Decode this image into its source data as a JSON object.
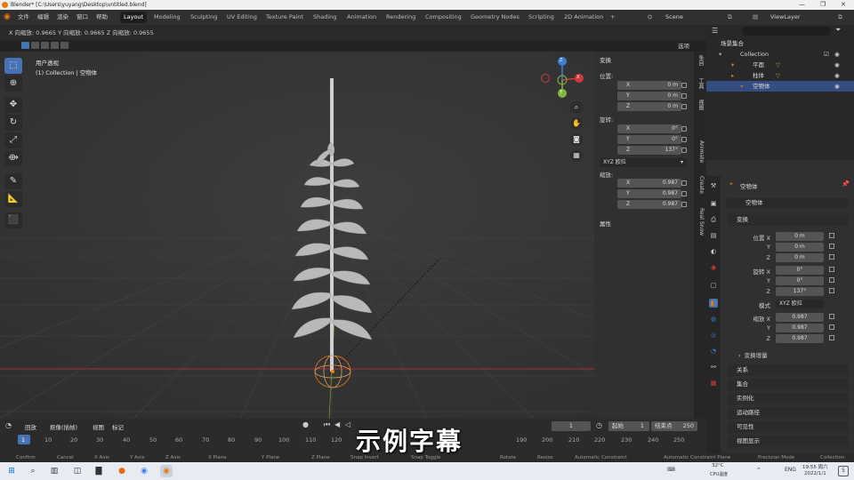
{
  "title_bar": {
    "title": "Blender* [C:\\Users\\yuyang\\Desktop\\untitled.blend]",
    "minimize": "—",
    "maximize": "❐",
    "close": "✕"
  },
  "menu": {
    "items": [
      "文件",
      "编辑",
      "渲染",
      "窗口",
      "帮助"
    ],
    "workspaces": [
      "Layout",
      "Modeling",
      "Sculpting",
      "UV Editing",
      "Texture Paint",
      "Shading",
      "Animation",
      "Rendering",
      "Compositing",
      "Geometry Nodes",
      "Scripting",
      "2D Animation"
    ],
    "active_workspace": "Layout",
    "add_tab": "+",
    "scene_name": "Scene",
    "view_layer": "ViewLayer"
  },
  "tool_header": {
    "scale_readout": "X 向缩放: 0.9665  Y 向缩放: 0.9665  Z 向缩放: 0.9655",
    "options_label": "选项"
  },
  "viewport": {
    "view_name": "用户透视",
    "context_line": "(1) Collection | 空物体",
    "gizmo_axes": {
      "x": "X",
      "y": "Y",
      "z": "Z"
    },
    "colors": {
      "bg": "#393939",
      "x_axis": "#d43a3a",
      "y_axis": "#7fb83a",
      "z_axis": "#3b7fd6"
    }
  },
  "n_panel": {
    "transform_header": "变换",
    "location_label": "位置:",
    "location": [
      {
        "axis": "X",
        "value": "0 m"
      },
      {
        "axis": "Y",
        "value": "0 m"
      },
      {
        "axis": "Z",
        "value": "0 m"
      }
    ],
    "rotation_label": "旋转:",
    "rotation": [
      {
        "axis": "X",
        "value": "0°"
      },
      {
        "axis": "Y",
        "value": "0°"
      },
      {
        "axis": "Z",
        "value": "137°"
      }
    ],
    "rotation_mode": "XYZ 欧拉",
    "scale_label": "缩放:",
    "scale": [
      {
        "axis": "X",
        "value": "0.987"
      },
      {
        "axis": "Y",
        "value": "0.987"
      },
      {
        "axis": "Z",
        "value": "0.987"
      }
    ],
    "properties_header": "属性"
  },
  "side_tabs": [
    "条目",
    "工具",
    "视图",
    "Animate",
    "Create",
    "Real Snow"
  ],
  "outliner": {
    "root": "场景集合",
    "rows": [
      {
        "label": "Collection",
        "selected": false
      },
      {
        "label": "平面",
        "selected": false
      },
      {
        "label": "柱体",
        "selected": false
      },
      {
        "label": "空物体",
        "selected": true
      }
    ]
  },
  "properties": {
    "object_name": "空物体",
    "object_name_field": "空物体",
    "transform_header": "变换",
    "location_label": "位置 X",
    "location": [
      "0 m",
      "0 m",
      "0 m"
    ],
    "rotation_label": "旋转 X",
    "rotation": [
      "0°",
      "0°",
      "137°"
    ],
    "mode_label": "模式",
    "mode_value": "XYZ 欧拉",
    "scale_label": "缩放 X",
    "scale": [
      "0.987",
      "0.987",
      "0.987"
    ],
    "axis_y": "Y",
    "axis_z": "Z",
    "delta_transform": "变换增量",
    "sections": [
      "关系",
      "集合",
      "实例化",
      "运动路径",
      "可见性",
      "视图显示"
    ]
  },
  "timeline": {
    "playback_label": "回放",
    "keying_label": "抠像(插帧)",
    "view_label": "视图",
    "marker_label": "标记",
    "current_frame": "1",
    "start_label": "起始",
    "start_value": "1",
    "end_label": "结束点",
    "end_value": "250",
    "ticks": [
      "1",
      "10",
      "20",
      "30",
      "40",
      "50",
      "60",
      "70",
      "80",
      "90",
      "100",
      "110",
      "120",
      "190",
      "200",
      "210",
      "220",
      "230",
      "240",
      "250"
    ]
  },
  "status_bar": {
    "items": [
      "Confirm",
      "Cancel",
      "X Axis",
      "Y Axis",
      "Z Axis",
      "X Plane",
      "Y Plane",
      "Z Plane",
      "Snap Invert",
      "Snap Toggle",
      "Rotate",
      "Resize",
      "Automatic Constraint",
      "Automatic Constraint Plane",
      "Precision Mode"
    ],
    "right_text": "Collection"
  },
  "taskbar": {
    "temp": "32°C",
    "temp_sub": "CPU温度",
    "lang": "ENG",
    "time": "19:55 周六",
    "date": "2022/1/1",
    "notif": "5"
  },
  "subtitle": "示例字幕"
}
